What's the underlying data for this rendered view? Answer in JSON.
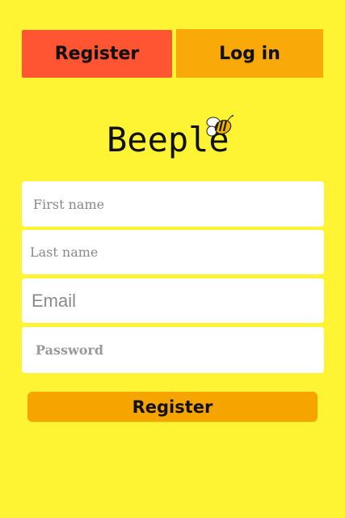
{
  "tabs": {
    "register_label": "Register",
    "login_label": "Log in"
  },
  "logo": {
    "text": "Beeple",
    "icon": "bee-icon"
  },
  "form": {
    "first_name_placeholder": "First name",
    "last_name_placeholder": "Last name",
    "email_placeholder": "Email",
    "password_placeholder": "Password",
    "submit_label": "Register"
  },
  "colors": {
    "background": "#FEF433",
    "register_tab": "#FF5533",
    "login_tab": "#F9AA08",
    "submit_button": "#F6A400"
  }
}
